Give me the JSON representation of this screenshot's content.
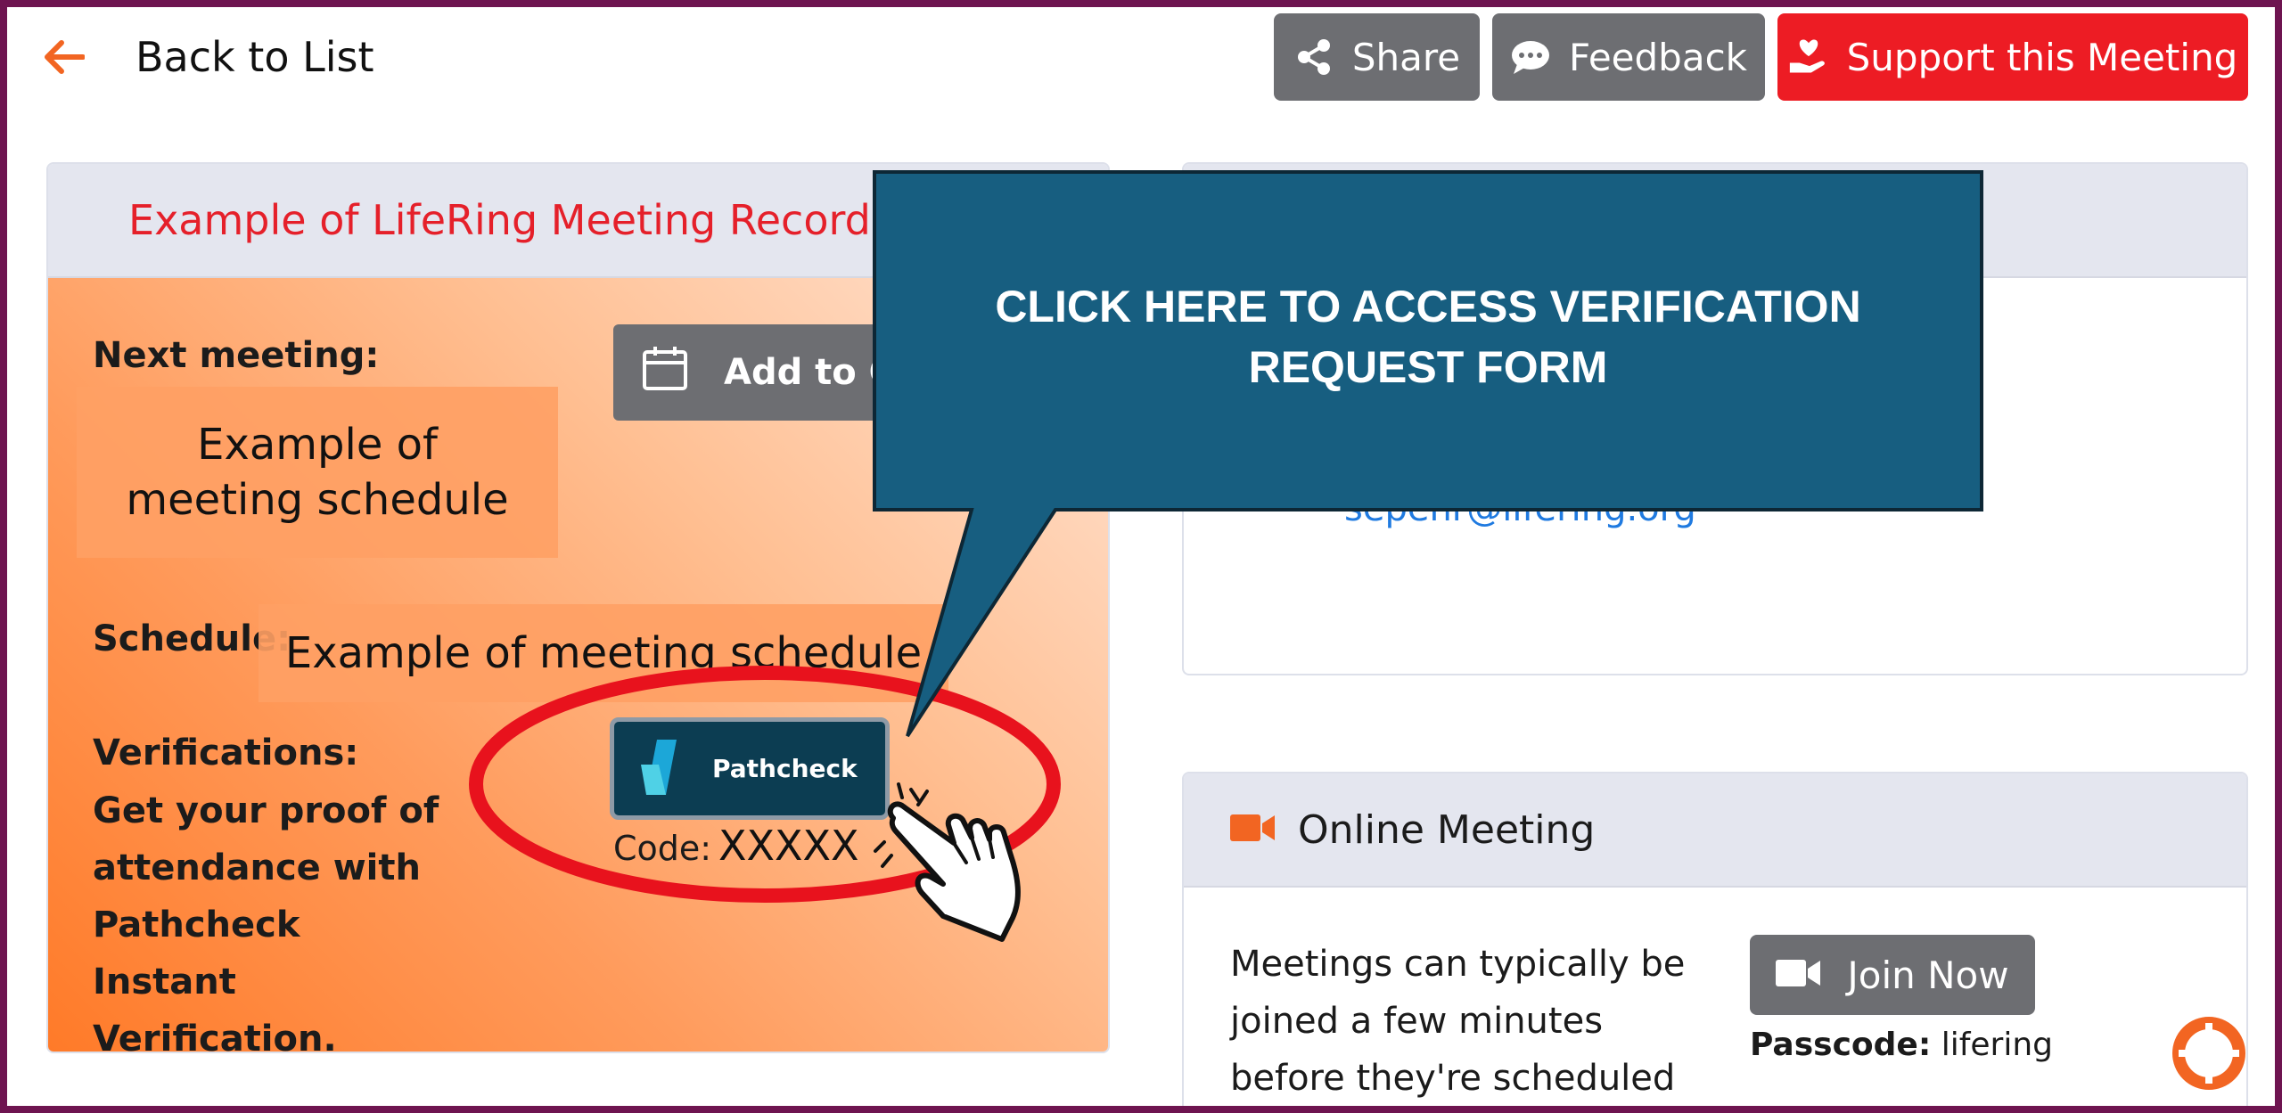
{
  "topbar": {
    "back_label": "Back to List",
    "share_label": "Share",
    "feedback_label": "Feedback",
    "support_label": "Support this Meeting"
  },
  "meeting_card": {
    "title": "Example of LifeRing Meeting Record",
    "next_meeting_label": "Next meeting:",
    "next_meeting_value": "Example of meeting schedule",
    "add_to_calendar_label": "Add to Ca",
    "schedule_label": "Schedule:",
    "schedule_value": "Example of meeting schedule",
    "verifications_label": "Verifications:",
    "verifications_text": "Get your proof of attendance with Pathcheck Instant Verification.",
    "pathcheck_label": "Pathcheck",
    "code_label": "Code:",
    "code_value": "XXXXX"
  },
  "contact_card": {
    "email": "sepehr@lifering.org"
  },
  "online_card": {
    "title": "Online Meeting",
    "description": "Meetings can typically be joined a few minutes before they're scheduled",
    "join_label": "Join Now",
    "passcode_label": "Passcode:",
    "passcode_value": "lifering"
  },
  "callout": {
    "text": "CLICK HERE TO ACCESS VERIFICATION REQUEST FORM"
  },
  "colors": {
    "frame": "#6e1450",
    "support_red": "#ed1c24",
    "gray_button": "#6d6e72",
    "callout_fill": "#175e80",
    "highlight_ring": "#e8121d",
    "accent_orange": "#f26522"
  },
  "icons": [
    "back-arrow-icon",
    "share-icon",
    "feedback-bubble-icon",
    "heart-hand-icon",
    "calendar-icon",
    "pathcheck-logo-icon",
    "video-camera-icon",
    "pointing-hand-icon",
    "lifering-logo-icon"
  ]
}
